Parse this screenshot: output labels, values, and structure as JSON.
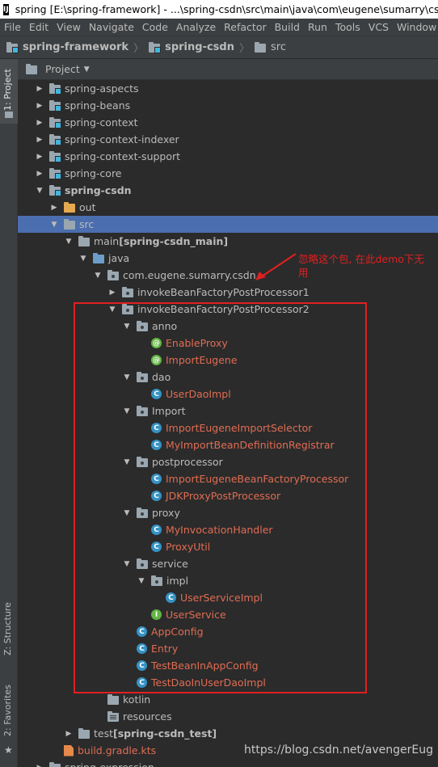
{
  "window": {
    "title": "spring [E:\\spring-framework] - ...\\spring-csdn\\src\\main\\java\\com\\eugene\\sumarry\\csdn\\i",
    "app_icon": "IJ"
  },
  "menu": [
    "File",
    "Edit",
    "View",
    "Navigate",
    "Code",
    "Analyze",
    "Refactor",
    "Build",
    "Run",
    "Tools",
    "VCS",
    "Window"
  ],
  "breadcrumb": [
    "spring-framework",
    "spring-csdn",
    "src"
  ],
  "side_tabs": {
    "project": "1: Project",
    "structure": "Z: Structure",
    "favorites": "2: Favorites"
  },
  "panel": {
    "title": "Project"
  },
  "tree": [
    {
      "label": "spring-aspects",
      "depth": 0,
      "arrow": "right",
      "icon": "folder-mod"
    },
    {
      "label": "spring-beans",
      "depth": 0,
      "arrow": "right",
      "icon": "folder-mod"
    },
    {
      "label": "spring-context",
      "depth": 0,
      "arrow": "right",
      "icon": "folder-mod"
    },
    {
      "label": "spring-context-indexer",
      "depth": 0,
      "arrow": "right",
      "icon": "folder-mod"
    },
    {
      "label": "spring-context-support",
      "depth": 0,
      "arrow": "right",
      "icon": "folder-mod"
    },
    {
      "label": "spring-core",
      "depth": 0,
      "arrow": "right",
      "icon": "folder-mod"
    },
    {
      "label": "spring-csdn",
      "depth": 0,
      "arrow": "down",
      "icon": "folder-mod",
      "bold": true
    },
    {
      "label": "out",
      "depth": 1,
      "arrow": "right",
      "icon": "folder-orange"
    },
    {
      "label": "src",
      "depth": 1,
      "arrow": "down",
      "icon": "folder",
      "selected": true
    },
    {
      "label": "main",
      "suffix": "[spring-csdn_main]",
      "depth": 2,
      "arrow": "down",
      "icon": "folder"
    },
    {
      "label": "java",
      "depth": 3,
      "arrow": "down",
      "icon": "folder-src"
    },
    {
      "label": "com.eugene.sumarry.csdn",
      "depth": 4,
      "arrow": "down",
      "icon": "folder-pkg"
    },
    {
      "label": "invokeBeanFactoryPostProcessor1",
      "depth": 5,
      "arrow": "right",
      "icon": "folder-pkg"
    },
    {
      "label": "invokeBeanFactoryPostProcessor2",
      "depth": 5,
      "arrow": "down",
      "icon": "folder-pkg"
    },
    {
      "label": "anno",
      "depth": 6,
      "arrow": "down",
      "icon": "folder-pkg"
    },
    {
      "label": "EnableProxy",
      "depth": 7,
      "arrow": "none",
      "icon": "annotation",
      "red": true
    },
    {
      "label": "ImportEugene",
      "depth": 7,
      "arrow": "none",
      "icon": "annotation",
      "red": true
    },
    {
      "label": "dao",
      "depth": 6,
      "arrow": "down",
      "icon": "folder-pkg"
    },
    {
      "label": "UserDaoImpl",
      "depth": 7,
      "arrow": "none",
      "icon": "class",
      "red": true
    },
    {
      "label": "Import",
      "depth": 6,
      "arrow": "down",
      "icon": "folder-pkg"
    },
    {
      "label": "ImportEugeneImportSelector",
      "depth": 7,
      "arrow": "none",
      "icon": "class",
      "red": true
    },
    {
      "label": "MyImportBeanDefinitionRegistrar",
      "depth": 7,
      "arrow": "none",
      "icon": "class",
      "red": true
    },
    {
      "label": "postprocessor",
      "depth": 6,
      "arrow": "down",
      "icon": "folder-pkg"
    },
    {
      "label": "ImportEugeneBeanFactoryProcessor",
      "depth": 7,
      "arrow": "none",
      "icon": "class",
      "red": true
    },
    {
      "label": "JDKProxyPostProcessor",
      "depth": 7,
      "arrow": "none",
      "icon": "class",
      "red": true
    },
    {
      "label": "proxy",
      "depth": 6,
      "arrow": "down",
      "icon": "folder-pkg"
    },
    {
      "label": "MyInvocationHandler",
      "depth": 7,
      "arrow": "none",
      "icon": "class",
      "red": true
    },
    {
      "label": "ProxyUtil",
      "depth": 7,
      "arrow": "none",
      "icon": "class",
      "red": true
    },
    {
      "label": "service",
      "depth": 6,
      "arrow": "down",
      "icon": "folder-pkg"
    },
    {
      "label": "impl",
      "depth": 7,
      "arrow": "down",
      "icon": "folder-pkg"
    },
    {
      "label": "UserServiceImpl",
      "depth": 8,
      "arrow": "none",
      "icon": "class",
      "red": true
    },
    {
      "label": "UserService",
      "depth": 7,
      "arrow": "none",
      "icon": "interface",
      "red": true
    },
    {
      "label": "AppConfig",
      "depth": 6,
      "arrow": "none",
      "icon": "class",
      "red": true
    },
    {
      "label": "Entry",
      "depth": 6,
      "arrow": "none",
      "icon": "class",
      "red": true
    },
    {
      "label": "TestBeanInAppConfig",
      "depth": 6,
      "arrow": "none",
      "icon": "class",
      "red": true
    },
    {
      "label": "TestDaoInUserDaoImpl",
      "depth": 6,
      "arrow": "none",
      "icon": "class",
      "red": true
    },
    {
      "label": "kotlin",
      "depth": 4,
      "arrow": "none",
      "icon": "folder"
    },
    {
      "label": "resources",
      "depth": 4,
      "arrow": "none",
      "icon": "folder-res"
    },
    {
      "label": "test",
      "suffix": "[spring-csdn_test]",
      "depth": 2,
      "arrow": "right",
      "icon": "folder"
    },
    {
      "label": "build.gradle.kts",
      "depth": 1,
      "arrow": "none",
      "icon": "gradle",
      "red": true
    },
    {
      "label": "spring-expression",
      "depth": 0,
      "arrow": "right",
      "icon": "folder-mod"
    }
  ],
  "annotation": "忽略这个包, 在此demo下无用",
  "watermark": "https://blog.csdn.net/avengerEug",
  "colors": {
    "background": "#2b2b2b",
    "selection": "#4b6eaf",
    "annotation_red": "#e02020",
    "file_red": "#e06c53"
  }
}
